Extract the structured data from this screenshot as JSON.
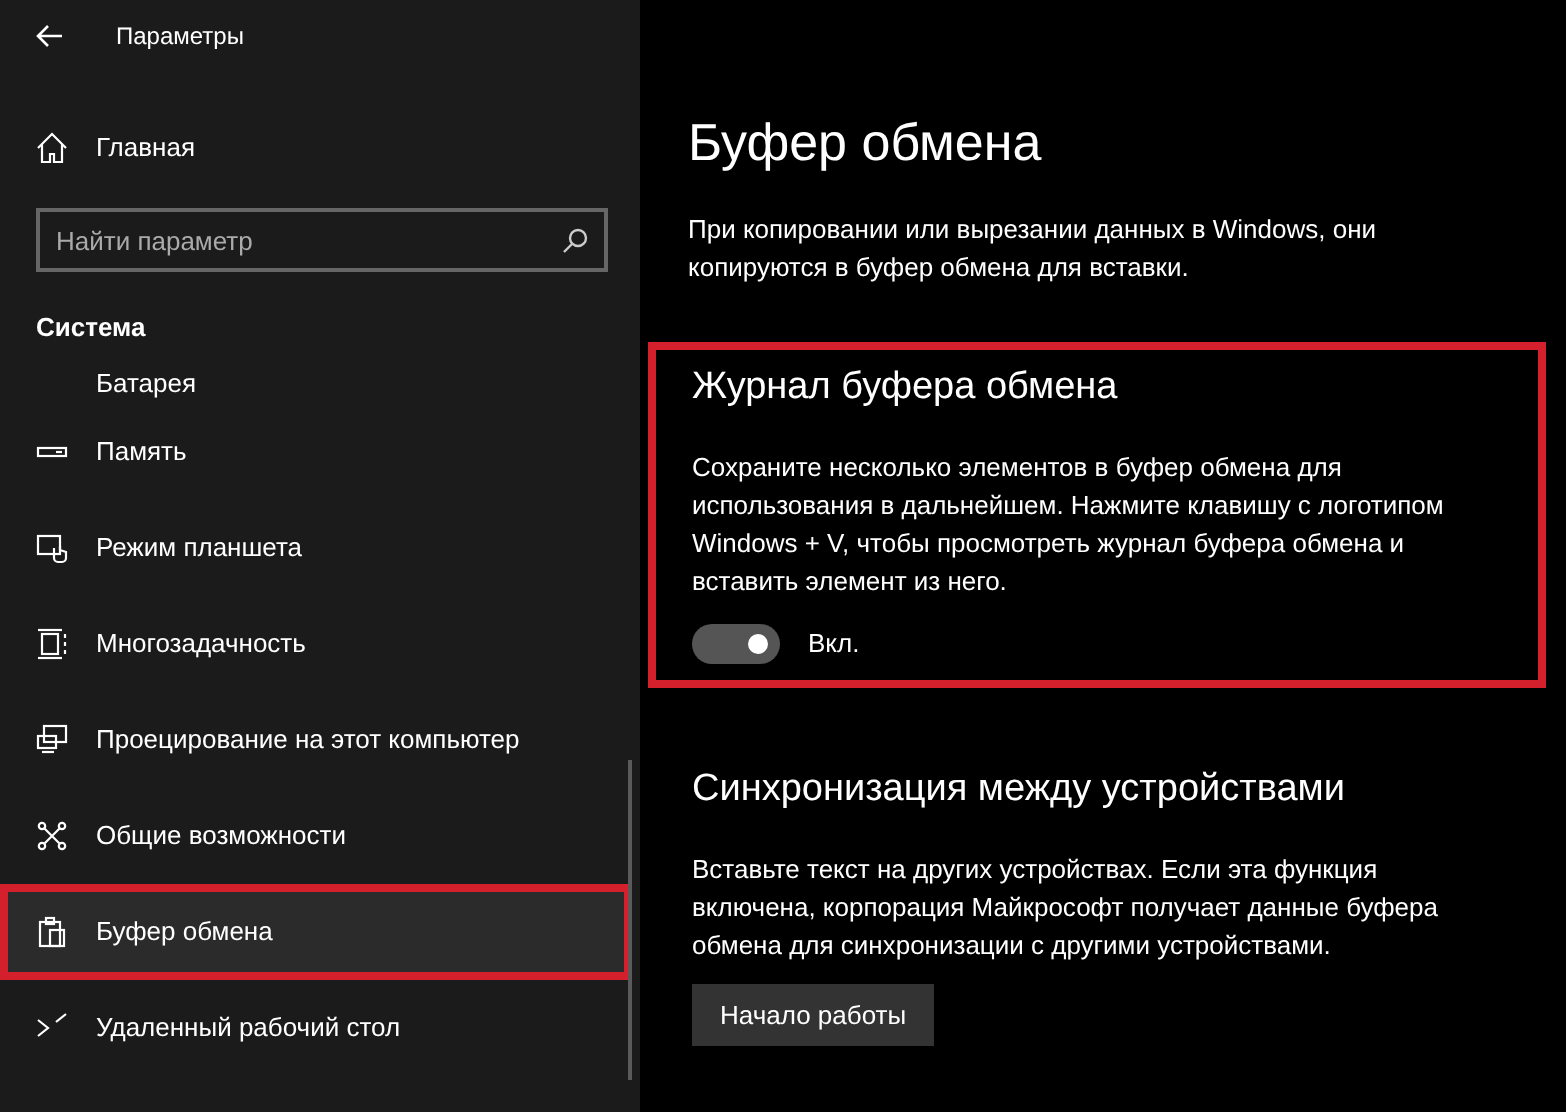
{
  "window": {
    "title": "Параметры"
  },
  "sidebar": {
    "home": "Главная",
    "search": {
      "placeholder": "Найти параметр"
    },
    "section": "Система",
    "items": [
      {
        "label": "Батарея",
        "selected": false,
        "highlighted": false
      },
      {
        "label": "Память",
        "selected": false,
        "highlighted": false
      },
      {
        "label": "Режим планшета",
        "selected": false,
        "highlighted": false
      },
      {
        "label": "Многозадачность",
        "selected": false,
        "highlighted": false
      },
      {
        "label": "Проецирование на этот компьютер",
        "selected": false,
        "highlighted": false
      },
      {
        "label": "Общие возможности",
        "selected": false,
        "highlighted": false
      },
      {
        "label": "Буфер обмена",
        "selected": true,
        "highlighted": true
      },
      {
        "label": "Удаленный рабочий стол",
        "selected": false,
        "highlighted": false
      }
    ]
  },
  "page": {
    "title": "Буфер обмена",
    "intro": "При копировании или вырезании данных в Windows, они копируются в буфер обмена для вставки.",
    "sections": [
      {
        "kind": "toggle",
        "heading": "Журнал буфера обмена",
        "text": "Сохраните несколько элементов в буфер обмена для использования в дальнейшем. Нажмите клавишу с логотипом Windows + V, чтобы просмотреть журнал буфера обмена и вставить элемент из него.",
        "on": true,
        "state_label": "Вкл.",
        "highlighted": true
      },
      {
        "kind": "button",
        "heading": "Синхронизация между устройствами",
        "text": "Вставьте текст на других устройствах. Если эта функция включена, корпорация Майкрософт получает данные буфера обмена для синхронизации с другими устройствами.",
        "button": "Начало работы"
      }
    ]
  }
}
